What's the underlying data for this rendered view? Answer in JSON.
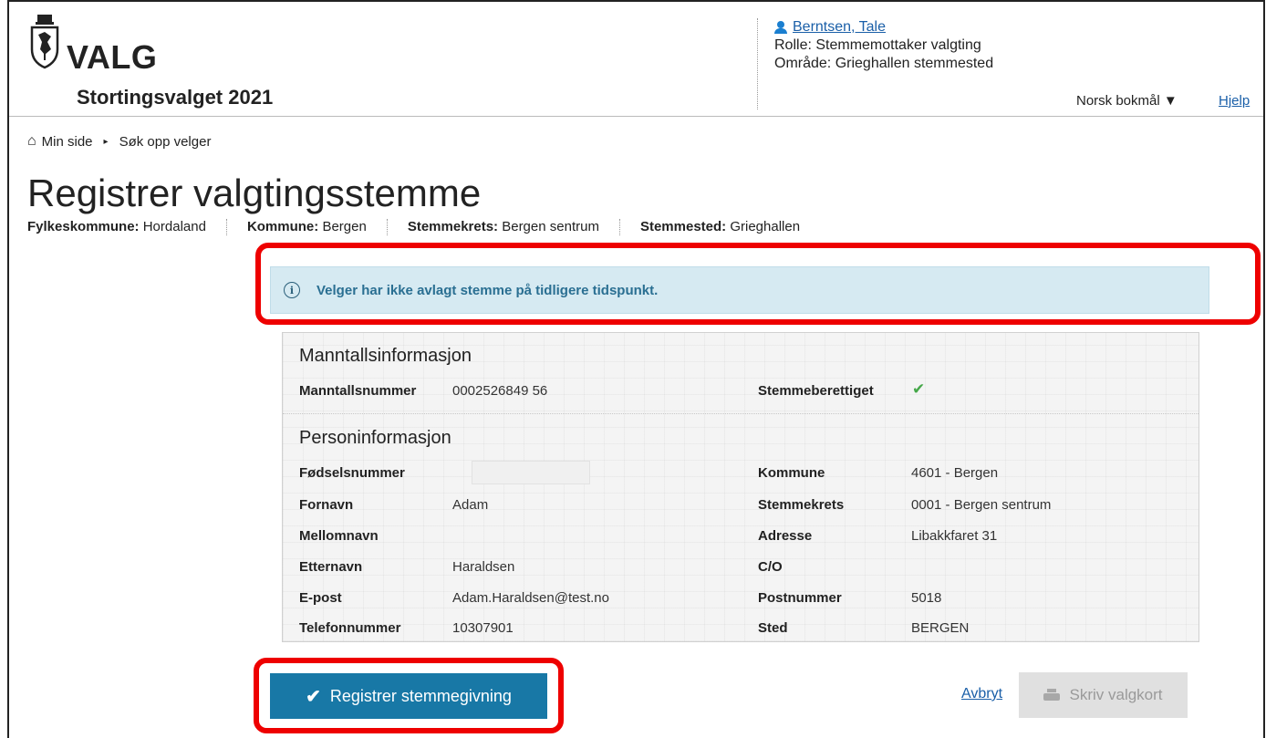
{
  "header": {
    "logo_text": "VALG",
    "election_name": "Stortingsvalget 2021",
    "user": {
      "name": "Berntsen, Tale",
      "role": "Rolle: Stemmemottaker valgting",
      "area": "Område: Grieghallen stemmested"
    },
    "language": "Norsk bokmål ▼",
    "help": "Hjelp"
  },
  "breadcrumb": {
    "home_icon": "home-icon",
    "home": "Min side",
    "separator": "▸",
    "current": "Søk opp velger"
  },
  "page": {
    "title": "Registrer valgtingsstemme",
    "context": [
      {
        "label": "Fylkeskommune:",
        "value": "Hordaland"
      },
      {
        "label": "Kommune:",
        "value": "Bergen"
      },
      {
        "label": "Stemmekrets:",
        "value": "Bergen sentrum"
      },
      {
        "label": "Stemmested:",
        "value": "Grieghallen"
      }
    ]
  },
  "alert": {
    "icon": "info-icon",
    "text": "Velger har ikke avlagt stemme på tidligere tidspunkt."
  },
  "manntall": {
    "title": "Manntallsinformasjon",
    "number_label": "Manntallsnummer",
    "number_value": "0002526849 56",
    "eligible_label": "Stemmeberettiget",
    "eligible_icon": "check-icon"
  },
  "person": {
    "title": "Personinformasjon",
    "left": [
      {
        "label": "Fødselsnummer",
        "value": ""
      },
      {
        "label": "Fornavn",
        "value": "Adam"
      },
      {
        "label": "Mellomnavn",
        "value": ""
      },
      {
        "label": "Etternavn",
        "value": "Haraldsen"
      },
      {
        "label": "E-post",
        "value": "Adam.Haraldsen@test.no"
      },
      {
        "label": "Telefonnummer",
        "value": "10307901"
      }
    ],
    "right": [
      {
        "label": "Kommune",
        "value": "4601 - Bergen"
      },
      {
        "label": "Stemmekrets",
        "value": "0001 - Bergen sentrum"
      },
      {
        "label": "Adresse",
        "value": "Libakkfaret 31"
      },
      {
        "label": "C/O",
        "value": ""
      },
      {
        "label": "Postnummer",
        "value": "5018"
      },
      {
        "label": "Sted",
        "value": "BERGEN"
      }
    ]
  },
  "actions": {
    "register": "Registrer stemmegivning",
    "cancel": "Avbryt",
    "print": "Skriv valgkort"
  },
  "colors": {
    "primary": "#1878a6",
    "highlight": "#ee0000",
    "alert_bg": "#d6eaf2",
    "link": "#1a5fa8",
    "check": "#46a84a"
  }
}
